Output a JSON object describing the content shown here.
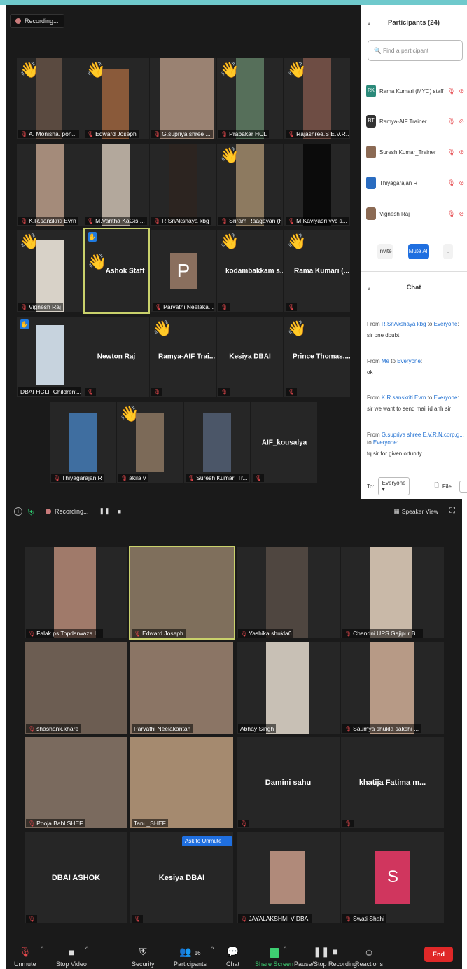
{
  "meeting1": {
    "recording_label": "Recording...",
    "tiles": [
      {
        "name": "A. Monisha. pon...",
        "wave": true
      },
      {
        "name": "Edward Joseph",
        "wave": true
      },
      {
        "name": "G.supriya shree ...",
        "wave": false
      },
      {
        "name": "Prabakar HCL",
        "wave": true
      },
      {
        "name": "Rajashree.S E.V.R...",
        "wave": true
      },
      {
        "name": "K.R.sanskriti Evrn",
        "wave": false
      },
      {
        "name": "M.Varitha KaGis ...",
        "wave": false
      },
      {
        "name": "R.SriAkshaya kbg",
        "wave": false
      },
      {
        "name": "Sriram Raagavan (H...",
        "wave": true
      },
      {
        "name": "M.Kaviyasri vvc s...",
        "wave": false
      },
      {
        "name": "Vignesh Raj",
        "wave": true
      },
      {
        "name": "Ashok Staff",
        "wave": true
      },
      {
        "name": "Parvathi Neelaka...",
        "wave": false,
        "avatar_letter": "P"
      },
      {
        "name": "kodambakkam s...",
        "wave": true
      },
      {
        "name": "Rama Kumari (...",
        "wave": true
      },
      {
        "name": "DBAI HCLF Children'...",
        "wave": false
      },
      {
        "name": "Newton Raj",
        "wave": false
      },
      {
        "name": "Ramya-AIF Trai...",
        "wave": true
      },
      {
        "name": "Kesiya DBAI",
        "wave": false
      },
      {
        "name": "Prince Thomas,...",
        "wave": true
      },
      {
        "name": "Thiyagarajan R",
        "wave": false
      },
      {
        "name": "akila v",
        "wave": true
      },
      {
        "name": "Suresh Kumar_Tr...",
        "wave": false
      },
      {
        "name": "AIF_kousalya",
        "wave": false
      }
    ]
  },
  "participants_panel": {
    "title": "Participants (24)",
    "search_placeholder": "Find a participant",
    "rows": [
      {
        "initials": "RK",
        "name": "Rama Kumari (MYC) staff"
      },
      {
        "initials": "RT",
        "name": "Ramya-AIF Trainer"
      },
      {
        "initials": "",
        "name": "Suresh Kumar_Trainer"
      },
      {
        "initials": "",
        "name": "Thiyagarajan R"
      },
      {
        "initials": "",
        "name": "Vignesh Raj"
      }
    ],
    "invite_label": "Invite",
    "mute_all_label": "Mute All",
    "more_label": "..",
    "chat_title": "Chat",
    "messages": [
      {
        "from": "R.SriAkshaya kbg",
        "to": "Everyone",
        "text": "sir one doubt"
      },
      {
        "from": "Me",
        "to": "Everyone",
        "text": "ok"
      },
      {
        "from": "K.R.sanskriti Evrn",
        "to": "Everyone",
        "text": "sir we want to send mail id ahh sir"
      },
      {
        "from": "G.supriya shree E.V.R.N.corp.g...",
        "to": "Everyone",
        "text": "tq sir for given ortunity"
      }
    ],
    "to_label": "To:",
    "to_value": "Everyone",
    "file_label": "File"
  },
  "meeting2": {
    "recording_label": "Recording...",
    "speaker_view_label": "Speaker View",
    "ask_unmute_label": "Ask to Unmute",
    "tiles": [
      {
        "name": "Falak ps Topdarwaza I..."
      },
      {
        "name": "Edward Joseph"
      },
      {
        "name": "Yashika shukla6"
      },
      {
        "name": "Chandni UPS Gajipur B..."
      },
      {
        "name": "shashank.khare"
      },
      {
        "name": "Parvathi Neelakantan"
      },
      {
        "name": "Abhay Singh"
      },
      {
        "name": "Saumya shukla sakshi ..."
      },
      {
        "name": "Pooja Bahl SHEF"
      },
      {
        "name": "Tanu_SHEF"
      },
      {
        "name": "Damini sahu"
      },
      {
        "name": "khatija Fatima m..."
      },
      {
        "name": "DBAI ASHOK"
      },
      {
        "name": "Kesiya DBAI"
      },
      {
        "name": "JAYALAKSHMI V DBAI"
      },
      {
        "name": "Swati Shahi",
        "avatar_letter": "S"
      }
    ],
    "toolbar": {
      "unmute": "Unmute",
      "stop_video": "Stop Video",
      "security": "Security",
      "participants": "Participants",
      "participants_count": "16",
      "chat": "Chat",
      "share_screen": "Share Screen",
      "pause_recording": "Pause/Stop Recording",
      "reactions": "Reactions",
      "end": "End"
    }
  }
}
